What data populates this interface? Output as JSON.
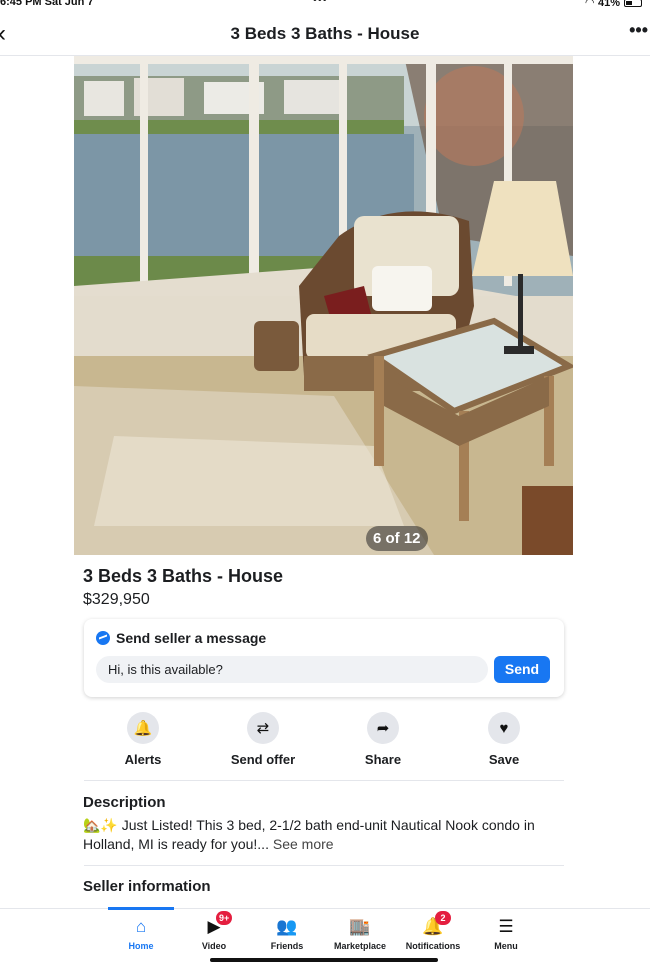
{
  "status": {
    "time": "6:45 PM  Sat Jun 7",
    "dots": "•••",
    "battery": "41%"
  },
  "header": {
    "title": "3 Beds 3 Baths - House",
    "back_icon": "‹",
    "more_icon": "•••"
  },
  "photo": {
    "counter": "6 of 12"
  },
  "listing": {
    "title": "3 Beds 3 Baths - House",
    "price": "$329,950"
  },
  "message": {
    "heading": "Send seller a message",
    "input_value": "Hi, is this available?",
    "send_label": "Send"
  },
  "actions": [
    {
      "label": "Alerts",
      "icon": "bell-icon",
      "glyph": "🔔"
    },
    {
      "label": "Send offer",
      "icon": "offer-icon",
      "glyph": "⇄"
    },
    {
      "label": "Share",
      "icon": "share-arrow-icon",
      "glyph": "➦"
    },
    {
      "label": "Save",
      "icon": "heart-icon",
      "glyph": "♥"
    }
  ],
  "description": {
    "title": "Description",
    "emoji": "🏡✨",
    "text": " Just Listed! This 3 bed, 2-1/2 bath end-unit Nautical Nook condo in Holland, MI is ready for you!...",
    "see_more": " See more"
  },
  "seller": {
    "title": "Seller information"
  },
  "bottom_nav": [
    {
      "label": "Home",
      "icon": "home-icon",
      "glyph": "⌂",
      "badge": ""
    },
    {
      "label": "Video",
      "icon": "video-icon",
      "glyph": "▶",
      "badge": "9+"
    },
    {
      "label": "Friends",
      "icon": "friends-icon",
      "glyph": "👥",
      "badge": ""
    },
    {
      "label": "Marketplace",
      "icon": "marketplace-icon",
      "glyph": "🏬",
      "badge": ""
    },
    {
      "label": "Notifications",
      "icon": "bell-icon",
      "glyph": "🔔",
      "badge": "2"
    },
    {
      "label": "Menu",
      "icon": "menu-icon",
      "glyph": "☰",
      "badge": ""
    }
  ],
  "colors": {
    "accent": "#1877f2",
    "badge": "#e41e3f"
  }
}
